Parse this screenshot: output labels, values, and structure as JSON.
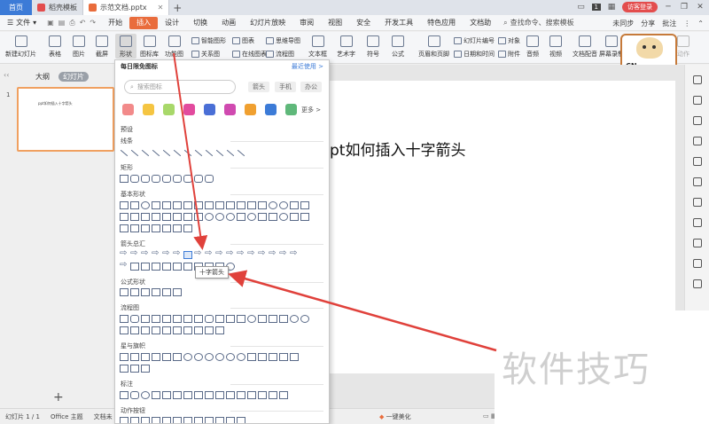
{
  "titlebar": {
    "home_tab": "首页",
    "tabs": [
      {
        "label": "稻壳模板",
        "icon_color": "#e34d4d"
      },
      {
        "label": "示范文档.pptx",
        "icon_color": "#e96c3c"
      }
    ],
    "page_badge": "1",
    "visitor_label": "访客登录"
  },
  "menubar": {
    "file_label": "文件",
    "items": [
      "开始",
      "插入",
      "设计",
      "切换",
      "动画",
      "幻灯片放映",
      "审阅",
      "视图",
      "安全",
      "开发工具",
      "特色应用",
      "文档助"
    ],
    "active_item": "插入",
    "search_label": "查找命令、搜索模板",
    "right_items": [
      "未同步",
      "分享",
      "批注"
    ]
  },
  "ribbon": {
    "new_slide": "新建幻灯片",
    "table": "表格",
    "picture": "图片",
    "screenshot": "截屏",
    "shapes": "形状",
    "icon_library": "图标库",
    "function_chart": "功能图",
    "smart_graphic": "智能图形",
    "chart": "图表",
    "mind_map": "思维导图",
    "more": "更多",
    "relation_chart": "关系图",
    "online_chart": "在线图表",
    "flow_chart": "流程图",
    "textbox": "文本框",
    "art_text": "艺术字",
    "symbol": "符号",
    "formula": "公式",
    "header_footer": "页眉和页脚",
    "slide_number": "幻灯片编号",
    "object": "对象",
    "date_time": "日期和时间",
    "attachment": "附件",
    "audio": "音频",
    "video": "视频",
    "doc_audio": "文档配音",
    "screen_record": "屏幕录制",
    "action": "动作"
  },
  "sticker": {
    "text": "CN",
    "frame_color": "#c67a3a"
  },
  "leftpanel": {
    "outline_tab": "大纲",
    "slides_tab": "幻灯片",
    "slide_number": "1",
    "thumb_text": "ppt如何插入十字箭头",
    "add_button": "+"
  },
  "slide": {
    "title": "pt如何插入十字箭头"
  },
  "dropdown": {
    "header": "每日限免图标",
    "recent": "最近使用 >",
    "search_placeholder": "搜索图标",
    "chips": [
      "箭头",
      "手机",
      "办公"
    ],
    "more_label": "更多 >",
    "preset_label": "预设",
    "categories": [
      "线条",
      "矩形",
      "基本形状",
      "箭头总汇",
      "公式形状",
      "流程图",
      "星与旗帜",
      "标注",
      "动作按钮"
    ],
    "tooltip": "十字箭头"
  },
  "statusbar": {
    "slide_info": "幻灯片 1 / 1",
    "theme": "Office 主题",
    "doc_label": "文档未",
    "beautify": "一键美化"
  },
  "watermark": {
    "text": "软件技巧"
  },
  "colors": {
    "accent": "#e96c3c",
    "annotation_arrow": "#e0413b",
    "home_tab": "#3c7bd7"
  }
}
